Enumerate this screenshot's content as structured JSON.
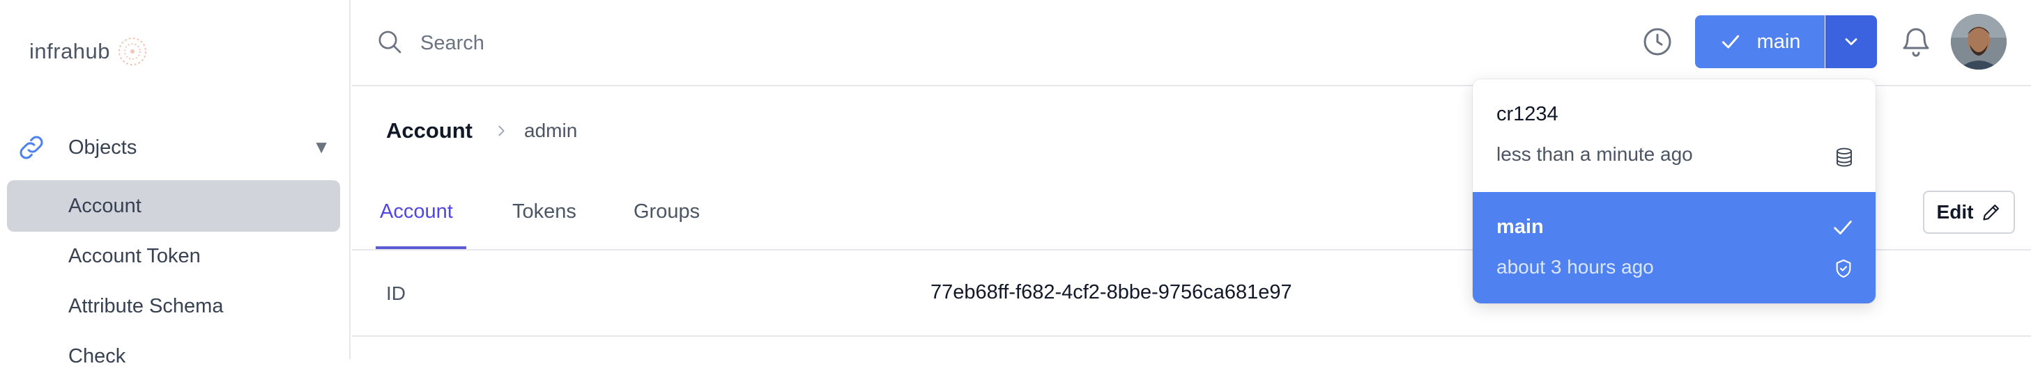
{
  "app": {
    "logo_text": "infrahub"
  },
  "sidebar": {
    "group": {
      "label": "Objects",
      "icon": "link-icon"
    },
    "items": [
      {
        "label": "Account",
        "active": true
      },
      {
        "label": "Account Token",
        "active": false
      },
      {
        "label": "Attribute Schema",
        "active": false
      },
      {
        "label": "Check",
        "active": false
      }
    ]
  },
  "search": {
    "placeholder": "Search",
    "value": ""
  },
  "header": {
    "branch_label": "main"
  },
  "breadcrumb": {
    "root": "Account",
    "leaf": "admin"
  },
  "tabs": [
    {
      "label": "Account",
      "active": true
    },
    {
      "label": "Tokens",
      "active": false
    },
    {
      "label": "Groups",
      "active": false
    }
  ],
  "actions": {
    "edit_label": "Edit"
  },
  "details": [
    {
      "label": "ID",
      "value": "77eb68ff-f682-4cf2-8bbe-9756ca681e97"
    }
  ],
  "branch_dropdown": {
    "items": [
      {
        "name": "cr1234",
        "time": "less than a minute ago",
        "icon": "database-icon",
        "selected": false
      },
      {
        "name": "main",
        "time": "about 3 hours ago",
        "icon": "shield-check-icon",
        "selected": true
      }
    ]
  },
  "colors": {
    "accent": "#4f81f0",
    "accent_dark": "#3b63e0",
    "tab_active": "#4f46e5",
    "sidebar_active_bg": "#d1d5db"
  }
}
